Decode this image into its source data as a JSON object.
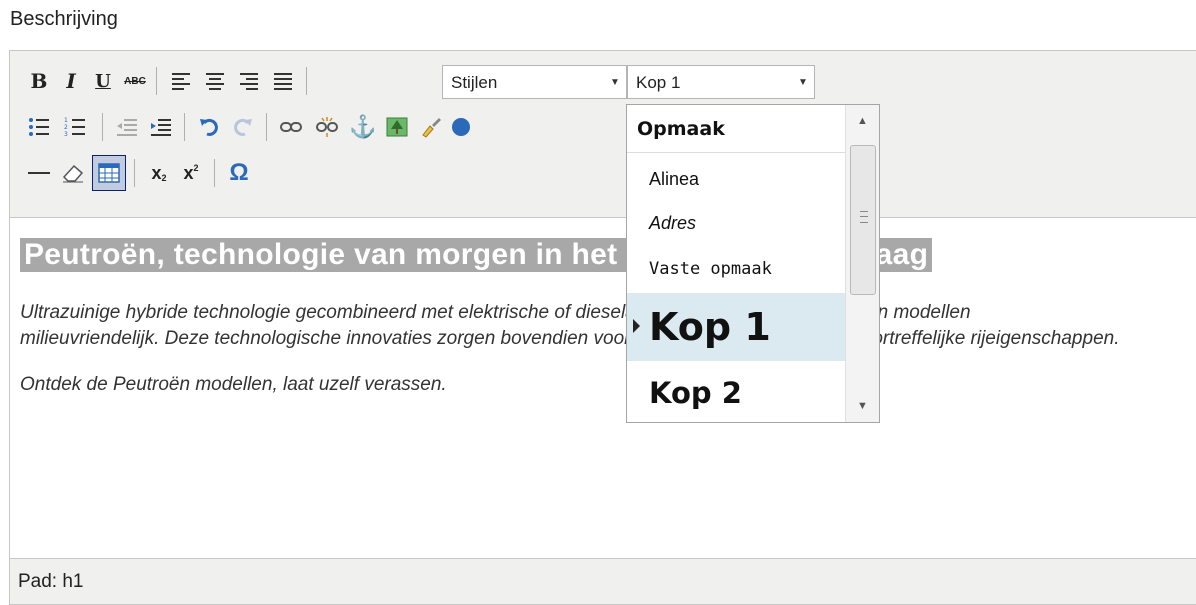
{
  "field_label": "Beschrijving",
  "toolbar": {
    "bold": "B",
    "italic": "I",
    "underline": "U",
    "strikethrough": "ABC",
    "styles_select": "Stijlen",
    "format_select": "Kop 1",
    "subscript": "x",
    "superscript": "x",
    "special_char": "Ω"
  },
  "content": {
    "heading": "Peutroën, technologie van morgen in het aanbod van vandaag",
    "paragraph_line1": "Ultrazuinige hybride technologie gecombineerd met elektrische of dieselaandrijving maken de Peutroën modellen",
    "paragraph_line2": "milieuvriendelijk. Deze technologische innovaties zorgen bovendien voor uitstekende prestaties en voortreffelijke rijeigenschappen.",
    "paragraph2": "Ontdek de Peutroën modellen, laat uzelf verassen."
  },
  "statusbar": {
    "path": "Pad: h1"
  },
  "format_dropdown": {
    "header": "Opmaak",
    "items": [
      {
        "label": "Alinea"
      },
      {
        "label": "Adres"
      },
      {
        "label": "Vaste opmaak"
      },
      {
        "label": "Kop 1",
        "selected": true
      },
      {
        "label": "Kop 2"
      }
    ]
  },
  "colors": {
    "toolbar_bg": "#f0f0ee",
    "heading_highlight": "#a8a8a8",
    "dropdown_selected_bg": "#dbe9f1"
  }
}
